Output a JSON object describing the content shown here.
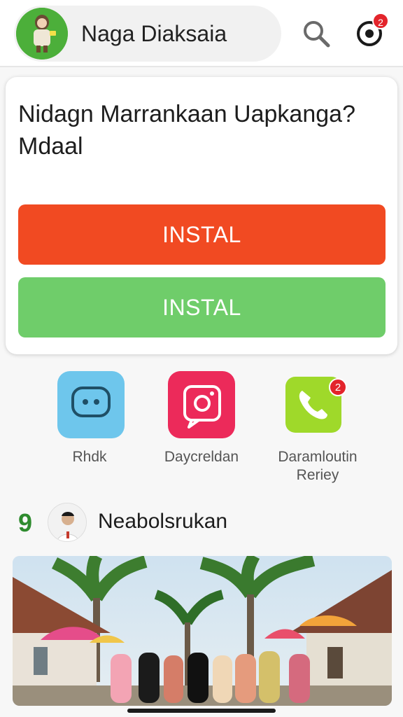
{
  "header": {
    "title": "Naga Diaksaia",
    "notification_count": "2",
    "icons": {
      "search": "search-icon",
      "notifications": "notifications-icon"
    }
  },
  "card": {
    "question": "Nidagn Marrankaan Uapkanga? Mdaal",
    "primary_button": "INSTAL",
    "secondary_button": "INSTAL",
    "colors": {
      "primary": "#f14a22",
      "secondary": "#6fcd6a"
    }
  },
  "apps": [
    {
      "label": "Rhdk",
      "icon": "chat-bubble-icon",
      "color": "#6ec6ec"
    },
    {
      "label": "Daycreldan",
      "icon": "camera-icon",
      "color": "#ec2a5a"
    },
    {
      "label": "Daramloutin Reriey",
      "icon": "phone-icon",
      "color": "#9fd92a",
      "badge": "2"
    }
  ],
  "feed": {
    "number": "9",
    "name": "Neabolsrukan"
  }
}
